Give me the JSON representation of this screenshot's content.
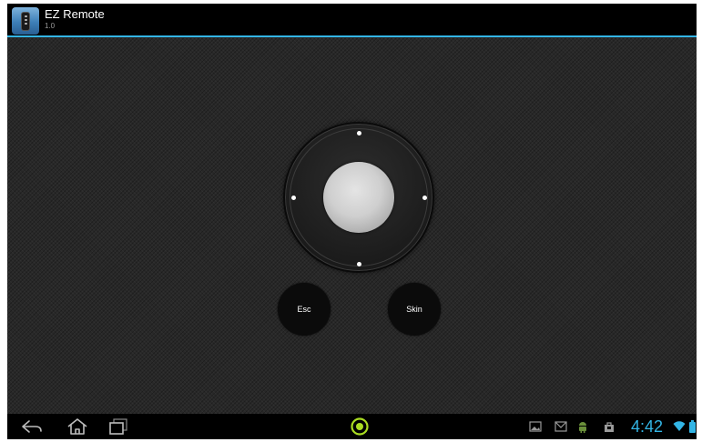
{
  "app": {
    "title": "EZ Remote",
    "version": "1.0",
    "icon": "remote-app-icon"
  },
  "remote": {
    "dpad": {
      "directions": [
        "up",
        "down",
        "left",
        "right"
      ],
      "center": "select"
    },
    "buttons": {
      "esc_label": "Esc",
      "skin_label": "Skin"
    }
  },
  "system_bar": {
    "nav_icons": [
      "back-icon",
      "home-icon",
      "recent-apps-icon"
    ],
    "center_icon": "app-launcher-icon",
    "notification_icons": [
      "gallery-icon",
      "gmail-icon",
      "android-icon",
      "shopping-bag-icon"
    ],
    "time": "4:42",
    "status_icons": [
      "wifi-icon",
      "battery-icon"
    ]
  },
  "colors": {
    "accent": "#33b5e5",
    "background": "#282828",
    "action_bar": "#000000",
    "launcher_green": "#aadd22"
  }
}
